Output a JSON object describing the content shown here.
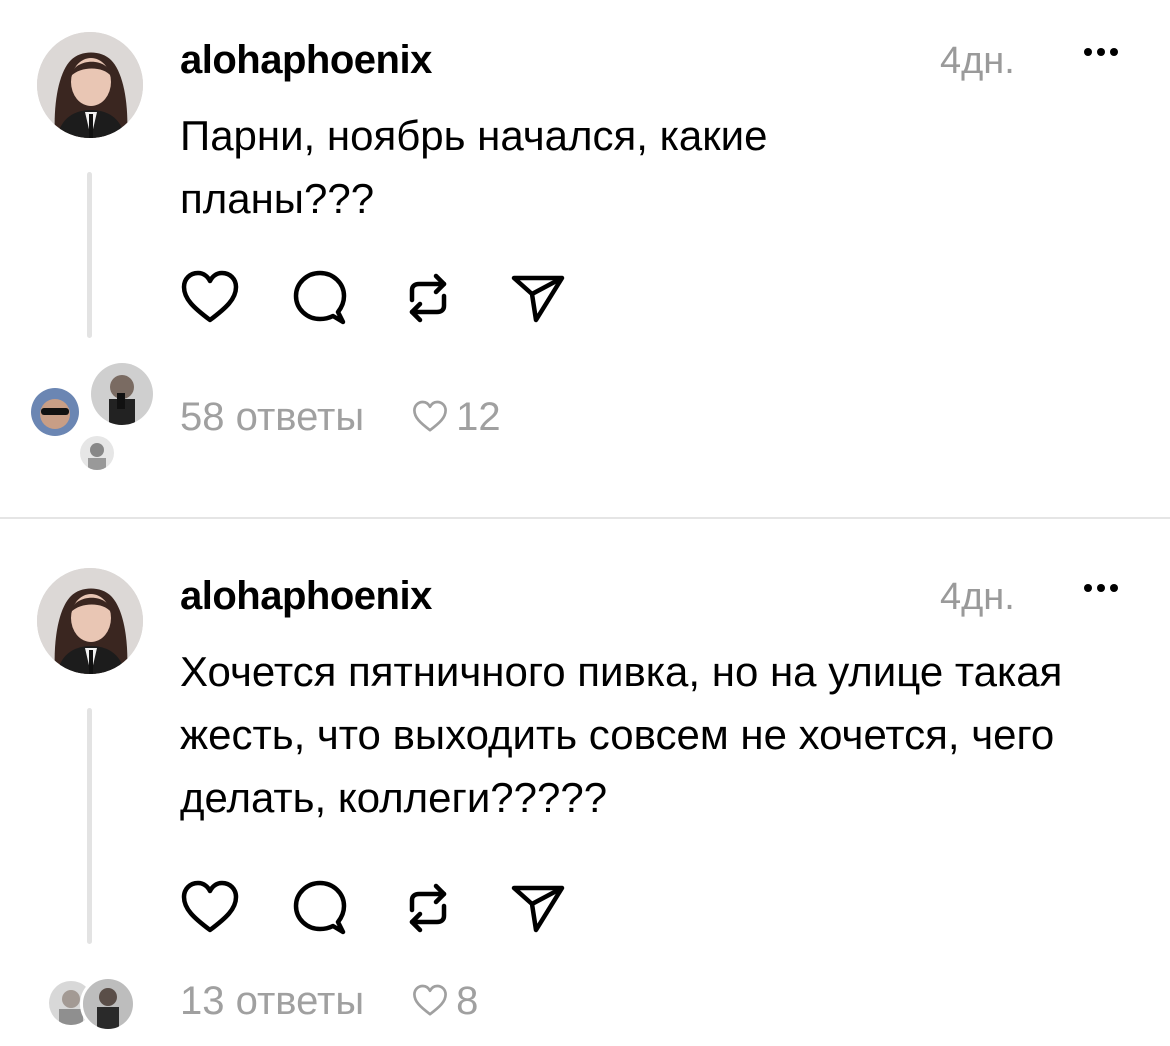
{
  "posts": [
    {
      "username": "alohaphoenix",
      "time": "4дн.",
      "text": "Парни, ноябрь начался, какие планы???",
      "replies": "58 ответы",
      "likes": "12"
    },
    {
      "username": "alohaphoenix",
      "time": "4дн.",
      "text": "Хочется пятничного пивка, но на улице такая жесть, что выходить совсем не хочется, чего делать, коллеги?????",
      "replies": "13 ответы",
      "likes": "8"
    }
  ],
  "icons": {
    "like": "heart-icon",
    "comment": "comment-icon",
    "repost": "repost-icon",
    "share": "share-icon",
    "more": "more-icon"
  },
  "colors": {
    "text": "#000000",
    "muted": "#9a9a9a",
    "divider": "#e5e5e5"
  }
}
